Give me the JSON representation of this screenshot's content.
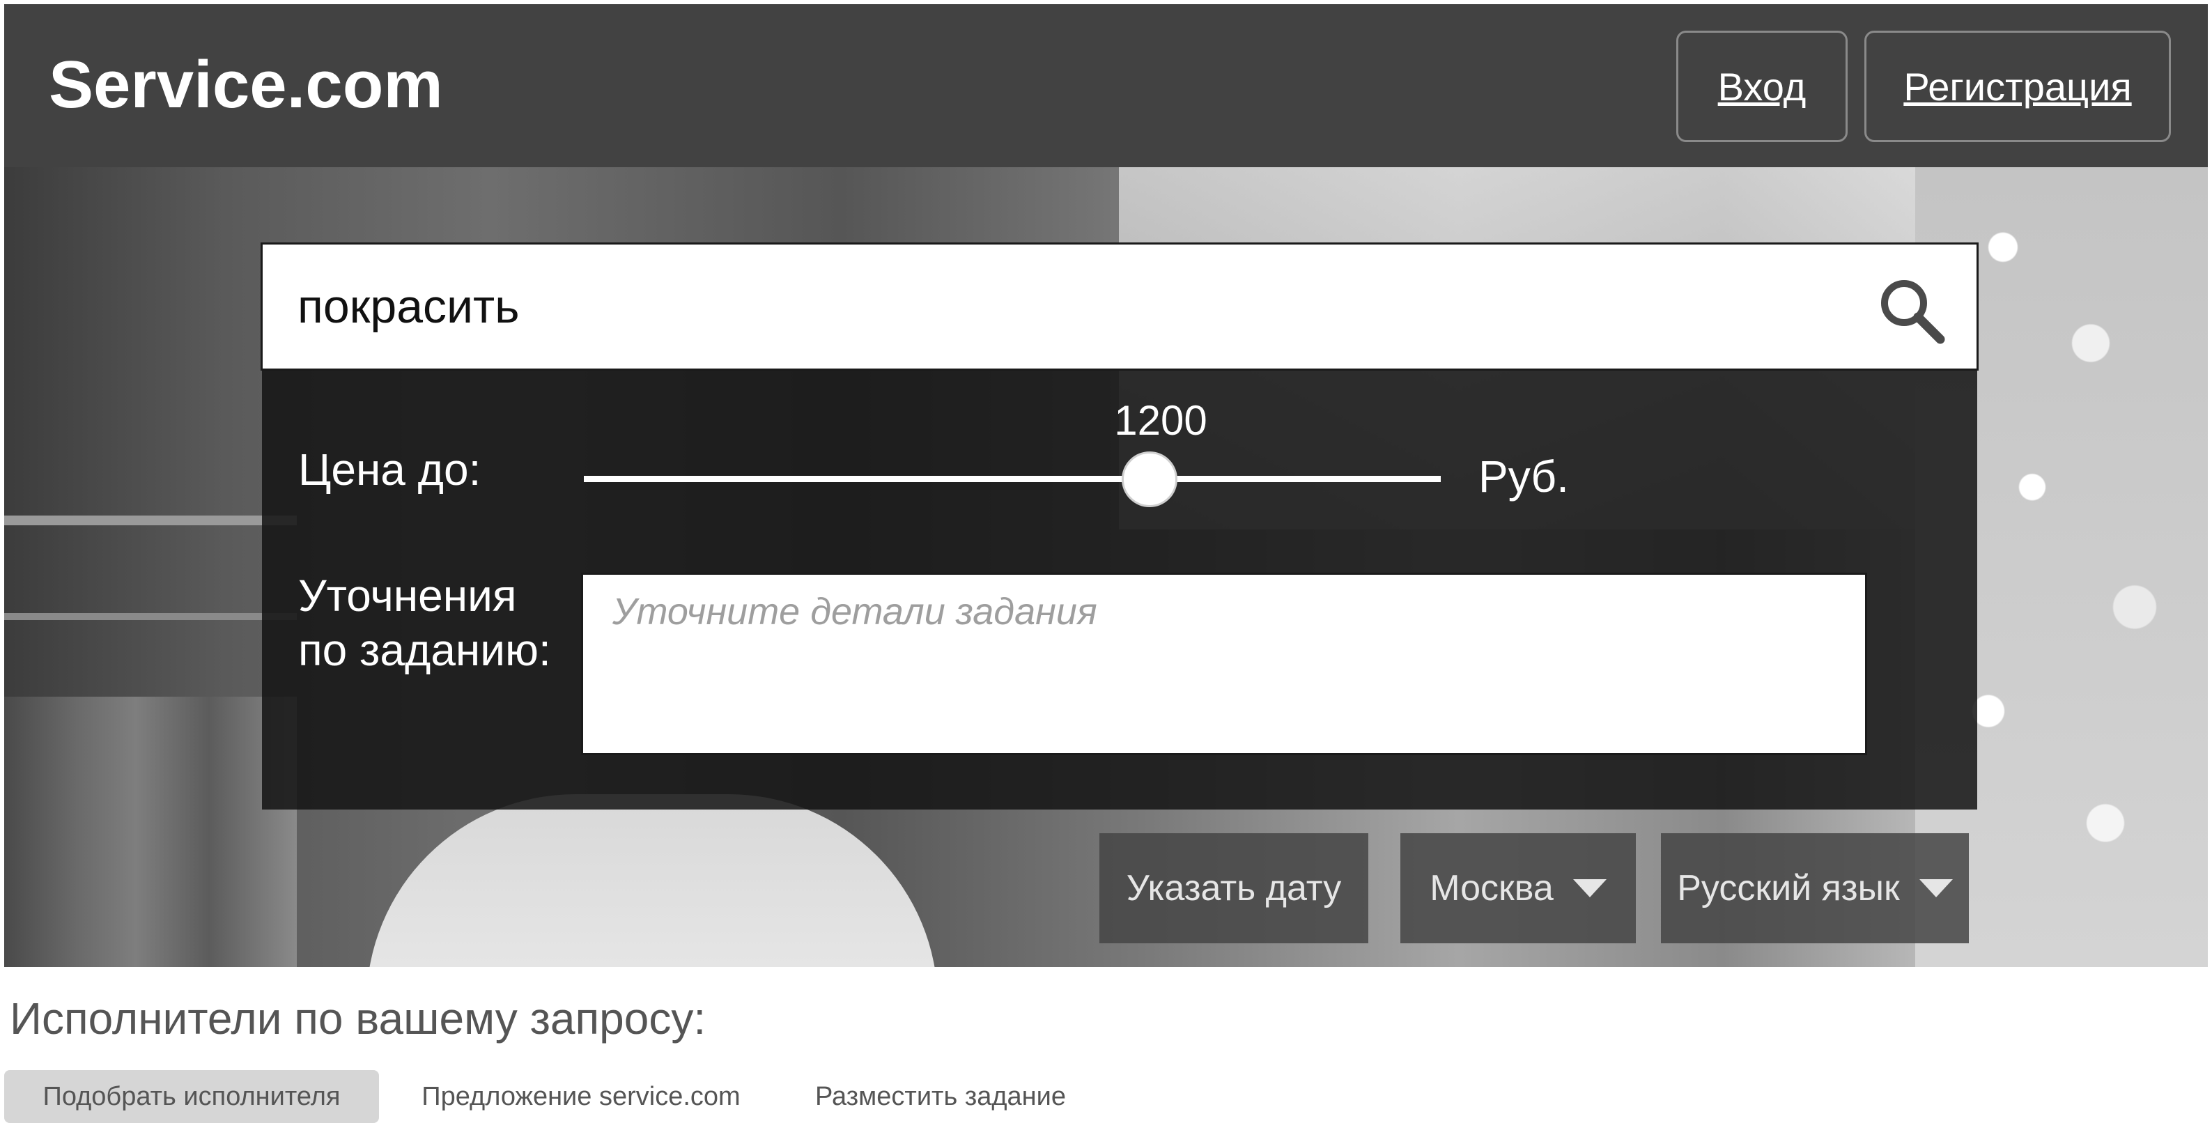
{
  "header": {
    "logo": "Service.com",
    "login_label": "Вход",
    "register_label": "Регистрация"
  },
  "search": {
    "value": "покрасить",
    "icon": "search-icon"
  },
  "filters": {
    "price_label": "Цена до:",
    "price_value": "1200",
    "price_fraction": 0.66,
    "price_unit": "Руб.",
    "details_label_line1": "Уточнения",
    "details_label_line2": "по заданию:",
    "details_placeholder": "Уточните детали задания"
  },
  "options": {
    "date_label": "Указать дату",
    "city_label": "Москва",
    "language_label": "Русский язык"
  },
  "results": {
    "title": "Исполнители по вашему запросу:",
    "tabs": [
      {
        "label": "Подобрать исполнителя",
        "active": true
      },
      {
        "label": "Предложение service.com",
        "active": false
      },
      {
        "label": "Разместить задание",
        "active": false
      }
    ]
  }
}
